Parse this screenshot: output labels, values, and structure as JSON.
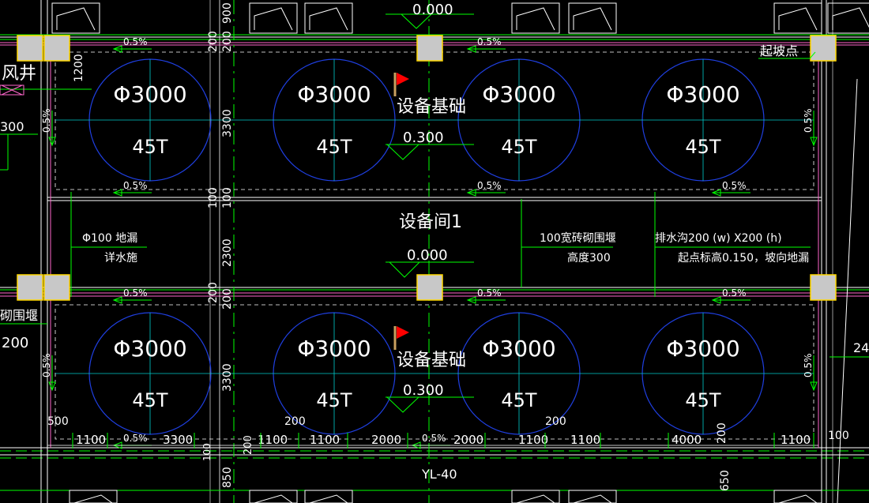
{
  "colors": {
    "background": "#000000",
    "wall": "#ffffff",
    "pink": "#ff66cc",
    "green": "#00ff00",
    "cyan": "#00cccc",
    "blue": "#1f3fe0",
    "column": "#c8c8c8",
    "column_outline": "#ffd700",
    "flag": "#ff0000"
  },
  "labels": {
    "elev_top": "0.000",
    "elev_mid": "0.000",
    "elev_base_top": "0.300",
    "elev_base_bot": "0.300",
    "equip_base_top": "设备基础",
    "equip_base_bot": "设备基础",
    "room_name": "设备间1",
    "slope_start": "起坡点",
    "wind_shaft": "风井",
    "drain_note_1": "Φ100 地漏",
    "drain_note_2": "详水施",
    "curb_note_1": "100宽砖砌围堰",
    "curb_note_2": "高度300",
    "trench_note_1": "排水沟200 (w) X200 (h)",
    "trench_note_2": "起点标高0.150，坡向地漏",
    "curb_left": "砌围堰",
    "beam": "YL-40",
    "left_300": "300",
    "left_200": "200",
    "right_24": "24",
    "right_100": "100"
  },
  "tanks": {
    "diameter": "Φ3000",
    "load": "45T",
    "count_per_row": 4
  },
  "slopes": [
    "0.5%"
  ],
  "dims": {
    "d900": "900",
    "d200": "200",
    "d1200": "1200",
    "d3300": "3300",
    "d100": "100",
    "d2300": "2300",
    "d500": "500",
    "d850": "850",
    "d650": "650",
    "bottom_row": [
      "1100",
      "3300",
      "1100",
      "1100",
      "2000",
      "2000",
      "1100",
      "1100",
      "4000",
      "1100"
    ]
  }
}
